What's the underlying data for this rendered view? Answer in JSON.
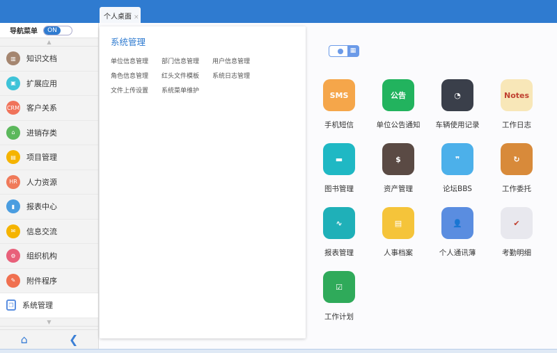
{
  "tabs": [
    {
      "label": "个人桌面",
      "close": "×"
    }
  ],
  "nav": {
    "label": "导航菜单",
    "toggle": "ON",
    "up": "▲",
    "down": "▼",
    "home": "⌂",
    "collapse": "❮"
  },
  "sidebar": {
    "items": [
      {
        "label": "知识文档",
        "icon": "book-icon",
        "glyph": "▥",
        "color": "#a58670"
      },
      {
        "label": "扩展应用",
        "icon": "extension-icon",
        "glyph": "▣",
        "color": "#3ec3d8"
      },
      {
        "label": "客户关系",
        "icon": "crm-icon",
        "glyph": "CRM",
        "color": "#f0735a"
      },
      {
        "label": "进销存类",
        "icon": "inventory-icon",
        "glyph": "⌂",
        "color": "#5cb85c"
      },
      {
        "label": "项目管理",
        "icon": "project-icon",
        "glyph": "▤",
        "color": "#f5b400"
      },
      {
        "label": "人力资源",
        "icon": "hr-icon",
        "glyph": "HR",
        "color": "#f07a5a"
      },
      {
        "label": "报表中心",
        "icon": "report-icon",
        "glyph": "▮",
        "color": "#4a9de0"
      },
      {
        "label": "信息交流",
        "icon": "message-icon",
        "glyph": "✉",
        "color": "#f5b400"
      },
      {
        "label": "组织机构",
        "icon": "org-icon",
        "glyph": "⚙",
        "color": "#e8607a"
      },
      {
        "label": "附件程序",
        "icon": "attachment-icon",
        "glyph": "✎",
        "color": "#f07050"
      },
      {
        "label": "系统管理",
        "icon": "system-icon",
        "glyph": "❐",
        "color": "#ffffff"
      }
    ]
  },
  "popup": {
    "title": "系统管理",
    "links": [
      "单位信息管理",
      "部门信息管理",
      "用户信息管理",
      "角色信息管理",
      "红头文件模板",
      "系统日志管理",
      "文件上传设置",
      "系统菜单维护"
    ]
  },
  "apps": [
    {
      "label": "手机短信",
      "glyph": "SMS",
      "color": "#f5a64a"
    },
    {
      "label": "单位公告通知",
      "glyph": "公告",
      "color": "#22b35e"
    },
    {
      "label": "车辆使用记录",
      "glyph": "◔",
      "color": "#3a3f4a"
    },
    {
      "label": "工作日志",
      "glyph": "Notes",
      "color": "#f8e7b8"
    },
    {
      "label": "图书管理",
      "glyph": "▬",
      "color": "#1fb8c4"
    },
    {
      "label": "资产管理",
      "glyph": "$",
      "color": "#5a4a44"
    },
    {
      "label": "论坛BBS",
      "glyph": "❞",
      "color": "#4cb0ea"
    },
    {
      "label": "工作委托",
      "glyph": "↻",
      "color": "#d88a3a"
    },
    {
      "label": "报表管理",
      "glyph": "∿",
      "color": "#1fb0b8"
    },
    {
      "label": "人事档案",
      "glyph": "▤",
      "color": "#f5c43a"
    },
    {
      "label": "个人通讯薄",
      "glyph": "👤",
      "color": "#5a8de0"
    },
    {
      "label": "考勤明细",
      "glyph": "✔",
      "color": "#e8e8ee"
    },
    {
      "label": "工作计划",
      "glyph": "☑",
      "color": "#2faa5a"
    }
  ]
}
